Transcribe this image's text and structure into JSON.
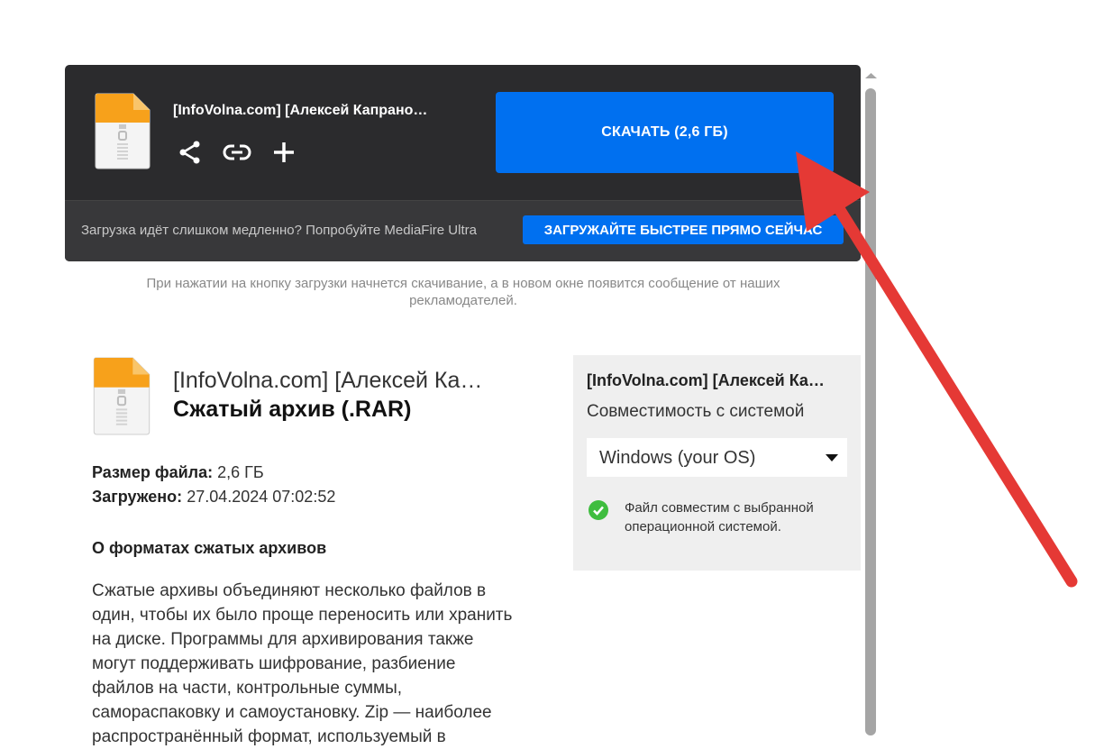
{
  "download_card": {
    "file_name": "[InfoVolna.com] [Алексей Капрано…",
    "download_button": "СКАЧАТЬ (2,6 ГБ)",
    "actions": [
      "share-icon",
      "link-icon",
      "plus-icon"
    ],
    "ultra_text": "Загрузка идёт слишком медленно? Попробуйте MediaFire Ultra",
    "ultra_button": "ЗАГРУЖАЙТЕ БЫСТРЕЕ ПРЯМО СЕЙЧАС"
  },
  "notice": "При нажатии на кнопку загрузки начнется скачивание, а в новом окне появится сообщение от наших рекламодателей.",
  "file_info": {
    "name": "[InfoVolna.com] [Алексей Ка…",
    "type": "Сжатый архив (.RAR)",
    "size_label": "Размер файла:",
    "size_value": "2,6 ГБ",
    "uploaded_label": "Загружено:",
    "uploaded_value": "27.04.2024 07:02:52"
  },
  "about": {
    "title": "О форматах сжатых архивов",
    "text": "Сжатые архивы объединяют несколько файлов в один, чтобы их было проще переносить или хранить на диске. Программы для архивирования также могут поддерживать шифрование, разбиение файлов на части, контрольные суммы, самораспаковку и самоустановку. Zip — наиболее распространённый формат, используемый в"
  },
  "compat": {
    "name": "[InfoVolna.com] [Алексей Ка…",
    "label": "Совместимость с системой",
    "os_selected": "Windows (your OS)",
    "ok_text": "Файл совместим с выбранной операционной системой."
  },
  "colors": {
    "card_bg": "#2b2b2d",
    "accent_blue": "#0070f0",
    "compat_bg": "#efefef",
    "ok_green": "#3fbd3f",
    "arrow_red": "#e53935"
  }
}
